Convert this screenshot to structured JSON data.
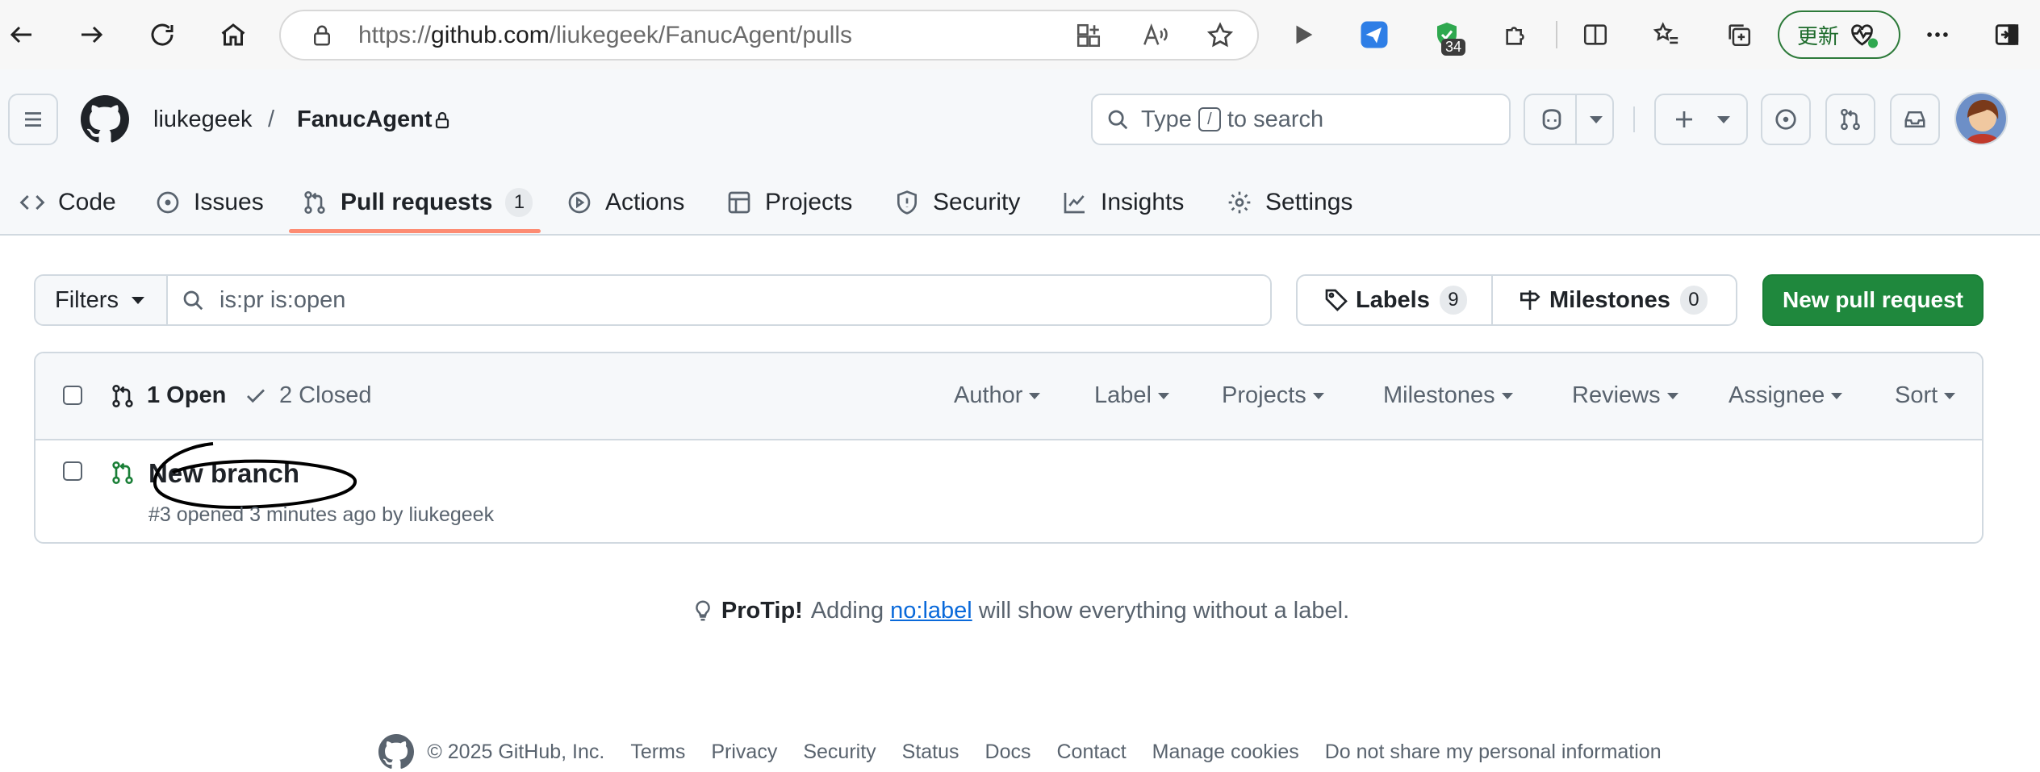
{
  "browser": {
    "url_prefix": "https://",
    "url_host": "github.com",
    "url_path": "/liukegeek/FanucAgent/pulls",
    "ext_badge": "34",
    "update_label": "更新"
  },
  "header": {
    "owner": "liukegeek",
    "separator": "/",
    "repo": "FanucAgent",
    "search_before": "Type",
    "search_key": "/",
    "search_after": "to search"
  },
  "tabs": [
    {
      "label": "Code",
      "icon": "code-icon"
    },
    {
      "label": "Issues",
      "icon": "issue-icon"
    },
    {
      "label": "Pull requests",
      "icon": "git-pull-request-icon",
      "count": "1",
      "selected": true
    },
    {
      "label": "Actions",
      "icon": "play-icon"
    },
    {
      "label": "Projects",
      "icon": "table-icon"
    },
    {
      "label": "Security",
      "icon": "shield-icon"
    },
    {
      "label": "Insights",
      "icon": "graph-icon"
    },
    {
      "label": "Settings",
      "icon": "gear-icon"
    }
  ],
  "filters": {
    "button": "Filters",
    "query": "is:pr is:open",
    "labels": "Labels",
    "labels_count": "9",
    "milestones": "Milestones",
    "milestones_count": "0",
    "new_pr": "New pull request"
  },
  "list": {
    "open": "1 Open",
    "closed": "2 Closed",
    "menus": [
      "Author",
      "Label",
      "Projects",
      "Milestones",
      "Reviews",
      "Assignee",
      "Sort"
    ],
    "items": [
      {
        "title": "New branch",
        "meta": "#3 opened 3 minutes ago by liukegeek"
      }
    ]
  },
  "protip": {
    "bold": "ProTip!",
    "before": "Adding",
    "link": "no:label",
    "after": "will show everything without a label."
  },
  "footer": {
    "copyright": "© 2025 GitHub, Inc.",
    "links": [
      "Terms",
      "Privacy",
      "Security",
      "Status",
      "Docs",
      "Contact",
      "Manage cookies",
      "Do not share my personal information"
    ]
  },
  "colors": {
    "accent_green": "#1f883d",
    "tab_underline": "#fd8c73",
    "link_blue": "#0969da",
    "open_green": "#1a7f37"
  }
}
